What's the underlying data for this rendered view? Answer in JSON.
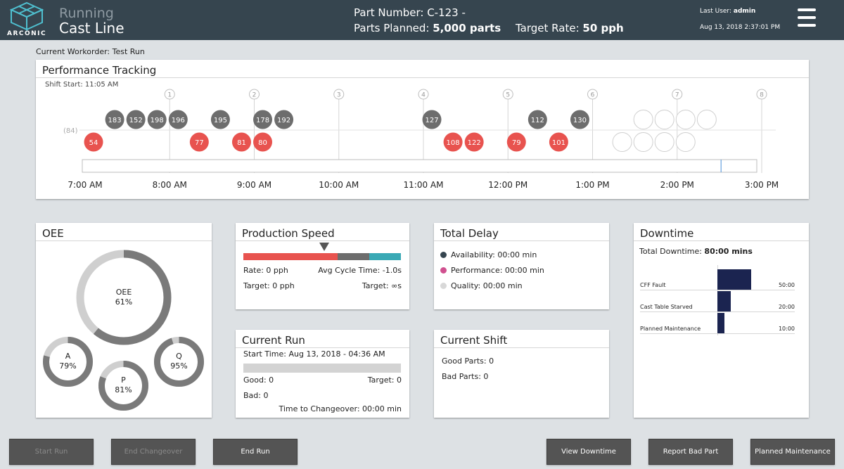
{
  "header": {
    "brand": "ARCONIC",
    "status": "Running",
    "line_name": "Cast Line",
    "part_number": "Part Number: C-123 -",
    "parts_planned_label": "Parts Planned:",
    "parts_planned_value": "5,000 parts",
    "target_rate_label": "Target Rate:",
    "target_rate_value": "50 pph",
    "last_user_label": "Last User:",
    "last_user_value": "admin",
    "datetime": "Aug 13, 2018 2:37:01 PM",
    "menu_icon": "hamburger-icon"
  },
  "workorder": "Current Workorder: Test Run",
  "performance": {
    "title": "Performance Tracking",
    "shift_start": "Shift Start: 11:05 AM",
    "hours": [
      "7:00 AM",
      "8:00 AM",
      "9:00 AM",
      "10:00 AM",
      "11:00 AM",
      "12:00 PM",
      "1:00 PM",
      "2:00 PM",
      "3:00 PM"
    ],
    "hour_markers": [
      "1",
      "2",
      "3",
      "4",
      "5",
      "6",
      "7",
      "8"
    ],
    "target_label": "(84)",
    "above_target": [
      "183",
      "152",
      "198",
      "196",
      "195",
      "178",
      "192",
      "127",
      "112",
      "130"
    ],
    "below_target": [
      "54",
      "77",
      "81",
      "80",
      "108",
      "122",
      "79",
      "101"
    ],
    "progress_fraction": 0.947,
    "colors": {
      "above": "#6d6d6d",
      "below": "#e8534f"
    }
  },
  "oee": {
    "title": "OEE",
    "main": {
      "label": "OEE",
      "value": "61%",
      "fraction": 0.61
    },
    "a": {
      "label": "A",
      "value": "79%",
      "fraction": 0.79
    },
    "p": {
      "label": "P",
      "value": "81%",
      "fraction": 0.81
    },
    "q": {
      "label": "Q",
      "value": "95%",
      "fraction": 0.95
    }
  },
  "speed": {
    "title": "Production Speed",
    "rate": "Rate: 0 pph",
    "avg_cycle": "Avg Cycle Time: -1.0s",
    "target": "Target: 0 pph",
    "target_cycle": "Target: ∞s",
    "colors": [
      "#e8534f",
      "#6d6d6d",
      "#3aa9b5"
    ]
  },
  "delay": {
    "title": "Total Delay",
    "items": [
      {
        "label": "Availability: 00:00 min",
        "color": "#36454f"
      },
      {
        "label": "Performance: 00:00 min",
        "color": "#d0508f"
      },
      {
        "label": "Quality: 00:00 min",
        "color": "#d8d8d8"
      }
    ]
  },
  "downtime": {
    "title": "Downtime",
    "total_label": "Total Downtime:",
    "total_value": "80:00 mins",
    "rows": [
      {
        "name": "CFF Fault",
        "value": "50:00",
        "minutes": 50
      },
      {
        "name": "Cast Table Starved",
        "value": "20:00",
        "minutes": 20
      },
      {
        "name": "Planned Maintenance",
        "value": "10:00",
        "minutes": 10
      }
    ]
  },
  "run": {
    "title": "Current Run",
    "start_time": "Start Time: Aug 13, 2018 - 04:36 AM",
    "good": "Good: 0",
    "target": "Target: 0",
    "bad": "Bad: 0",
    "changeover": "Time to Changeover: 00:00 min"
  },
  "shift": {
    "title": "Current Shift",
    "good": "Good Parts: 0",
    "bad": "Bad Parts: 0"
  },
  "buttons": {
    "start_run": "Start Run",
    "end_changeover": "End Changeover",
    "end_run": "End Run",
    "view_downtime": "View Downtime",
    "report_bad_part": "Report Bad Part",
    "planned_maintenance": "Planned Maintenance"
  }
}
